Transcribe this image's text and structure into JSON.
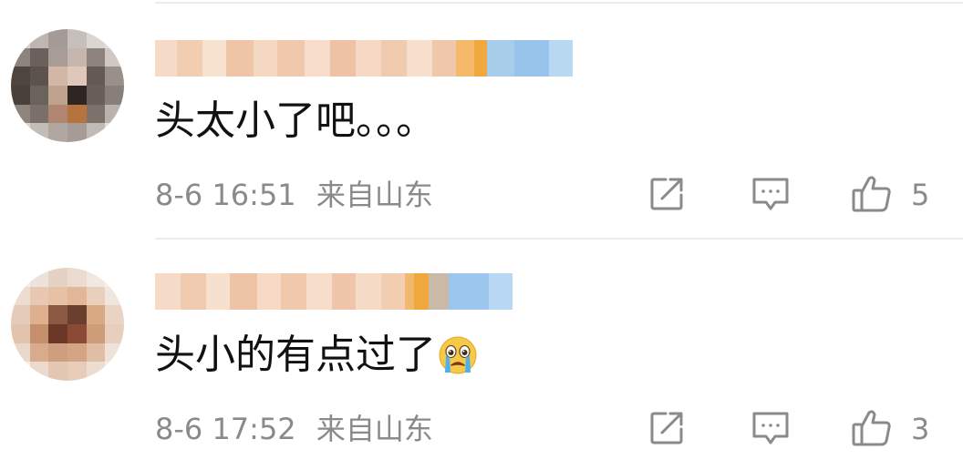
{
  "comments": [
    {
      "text": "头太小了吧。。。",
      "time": "8-6 16:51",
      "location": "来自山东",
      "likes": "5",
      "has_emoji": false
    },
    {
      "text": "头小的有点过了",
      "time": "8-6 17:52",
      "location": "来自山东",
      "likes": "3",
      "has_emoji": true,
      "emoji": "crying-face"
    }
  ],
  "icons": {
    "share": "share-icon",
    "comment": "comment-icon",
    "like": "thumbs-up-icon"
  },
  "colors": {
    "text": "#111111",
    "meta": "#8a8a8a",
    "icon": "#8a8a8a",
    "divider": "#ececec"
  }
}
